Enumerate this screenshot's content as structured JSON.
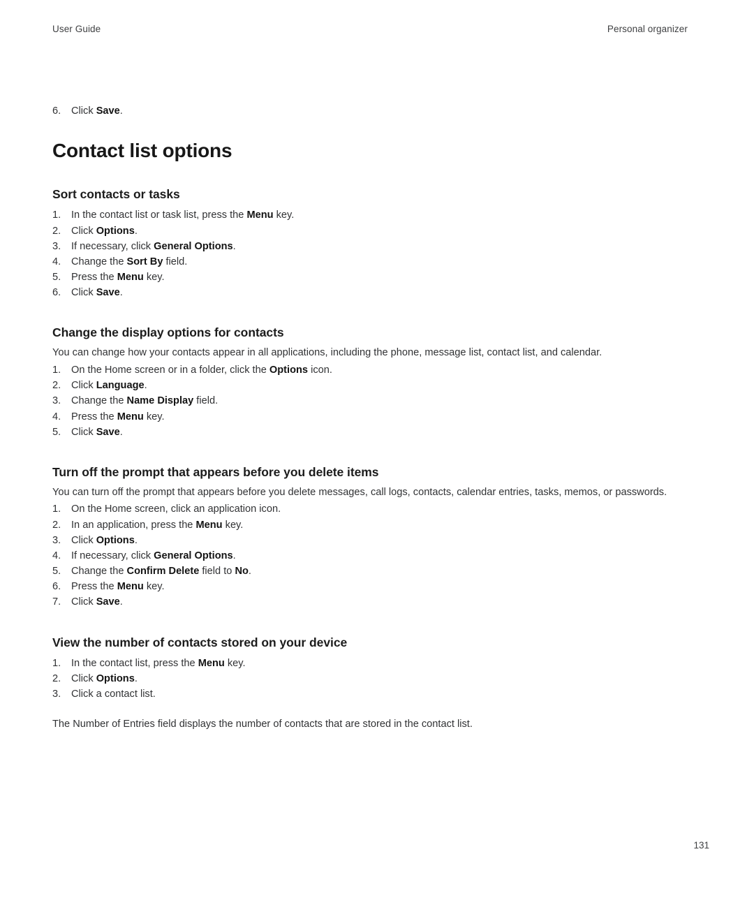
{
  "header": {
    "left": "User Guide",
    "right": "Personal organizer"
  },
  "carry_step": {
    "number": "6.",
    "parts": [
      {
        "t": "Click ",
        "b": false
      },
      {
        "t": "Save",
        "b": true
      },
      {
        "t": ".",
        "b": false
      }
    ]
  },
  "chapter_title": "Contact list options",
  "sections": [
    {
      "heading": "Sort contacts or tasks",
      "intro": null,
      "steps": [
        {
          "number": "1.",
          "parts": [
            {
              "t": "In the contact list or task list, press the ",
              "b": false
            },
            {
              "t": "Menu",
              "b": true
            },
            {
              "t": " key.",
              "b": false
            }
          ]
        },
        {
          "number": "2.",
          "parts": [
            {
              "t": "Click ",
              "b": false
            },
            {
              "t": "Options",
              "b": true
            },
            {
              "t": ".",
              "b": false
            }
          ]
        },
        {
          "number": "3.",
          "parts": [
            {
              "t": "If necessary, click ",
              "b": false
            },
            {
              "t": "General Options",
              "b": true
            },
            {
              "t": ".",
              "b": false
            }
          ]
        },
        {
          "number": "4.",
          "parts": [
            {
              "t": "Change the ",
              "b": false
            },
            {
              "t": "Sort By",
              "b": true
            },
            {
              "t": " field.",
              "b": false
            }
          ]
        },
        {
          "number": "5.",
          "parts": [
            {
              "t": "Press the ",
              "b": false
            },
            {
              "t": "Menu",
              "b": true
            },
            {
              "t": " key.",
              "b": false
            }
          ]
        },
        {
          "number": "6.",
          "parts": [
            {
              "t": "Click ",
              "b": false
            },
            {
              "t": "Save",
              "b": true
            },
            {
              "t": ".",
              "b": false
            }
          ]
        }
      ],
      "note": null
    },
    {
      "heading": "Change the display options for contacts",
      "intro": "You can change how your contacts appear in all applications, including the phone, message list, contact list, and calendar.",
      "steps": [
        {
          "number": "1.",
          "parts": [
            {
              "t": "On the Home screen or in a folder, click the ",
              "b": false
            },
            {
              "t": "Options",
              "b": true
            },
            {
              "t": " icon.",
              "b": false
            }
          ]
        },
        {
          "number": "2.",
          "parts": [
            {
              "t": "Click ",
              "b": false
            },
            {
              "t": "Language",
              "b": true
            },
            {
              "t": ".",
              "b": false
            }
          ]
        },
        {
          "number": "3.",
          "parts": [
            {
              "t": "Change the ",
              "b": false
            },
            {
              "t": "Name Display",
              "b": true
            },
            {
              "t": " field.",
              "b": false
            }
          ]
        },
        {
          "number": "4.",
          "parts": [
            {
              "t": "Press the ",
              "b": false
            },
            {
              "t": "Menu",
              "b": true
            },
            {
              "t": " key.",
              "b": false
            }
          ]
        },
        {
          "number": "5.",
          "parts": [
            {
              "t": "Click ",
              "b": false
            },
            {
              "t": "Save",
              "b": true
            },
            {
              "t": ".",
              "b": false
            }
          ]
        }
      ],
      "note": null
    },
    {
      "heading": "Turn off the prompt that appears before you delete items",
      "intro": "You can turn off the prompt that appears before you delete messages, call logs, contacts, calendar entries, tasks, memos, or passwords.",
      "steps": [
        {
          "number": "1.",
          "parts": [
            {
              "t": "On the Home screen, click an application icon.",
              "b": false
            }
          ]
        },
        {
          "number": "2.",
          "parts": [
            {
              "t": "In an application, press the ",
              "b": false
            },
            {
              "t": "Menu",
              "b": true
            },
            {
              "t": " key.",
              "b": false
            }
          ]
        },
        {
          "number": "3.",
          "parts": [
            {
              "t": "Click ",
              "b": false
            },
            {
              "t": "Options",
              "b": true
            },
            {
              "t": ".",
              "b": false
            }
          ]
        },
        {
          "number": "4.",
          "parts": [
            {
              "t": "If necessary, click ",
              "b": false
            },
            {
              "t": "General Options",
              "b": true
            },
            {
              "t": ".",
              "b": false
            }
          ]
        },
        {
          "number": "5.",
          "parts": [
            {
              "t": "Change the ",
              "b": false
            },
            {
              "t": "Confirm Delete",
              "b": true
            },
            {
              "t": " field to ",
              "b": false
            },
            {
              "t": "No",
              "b": true
            },
            {
              "t": ".",
              "b": false
            }
          ]
        },
        {
          "number": "6.",
          "parts": [
            {
              "t": "Press the ",
              "b": false
            },
            {
              "t": "Menu",
              "b": true
            },
            {
              "t": " key.",
              "b": false
            }
          ]
        },
        {
          "number": "7.",
          "parts": [
            {
              "t": "Click ",
              "b": false
            },
            {
              "t": "Save",
              "b": true
            },
            {
              "t": ".",
              "b": false
            }
          ]
        }
      ],
      "note": null
    },
    {
      "heading": "View the number of contacts stored on your device",
      "intro": null,
      "steps": [
        {
          "number": "1.",
          "parts": [
            {
              "t": "In the contact list, press the ",
              "b": false
            },
            {
              "t": "Menu",
              "b": true
            },
            {
              "t": " key.",
              "b": false
            }
          ]
        },
        {
          "number": "2.",
          "parts": [
            {
              "t": "Click ",
              "b": false
            },
            {
              "t": "Options",
              "b": true
            },
            {
              "t": ".",
              "b": false
            }
          ]
        },
        {
          "number": "3.",
          "parts": [
            {
              "t": "Click a contact list.",
              "b": false
            }
          ]
        }
      ],
      "note": "The Number of Entries field displays the number of contacts that are stored in the contact list."
    }
  ],
  "page_number": "131"
}
